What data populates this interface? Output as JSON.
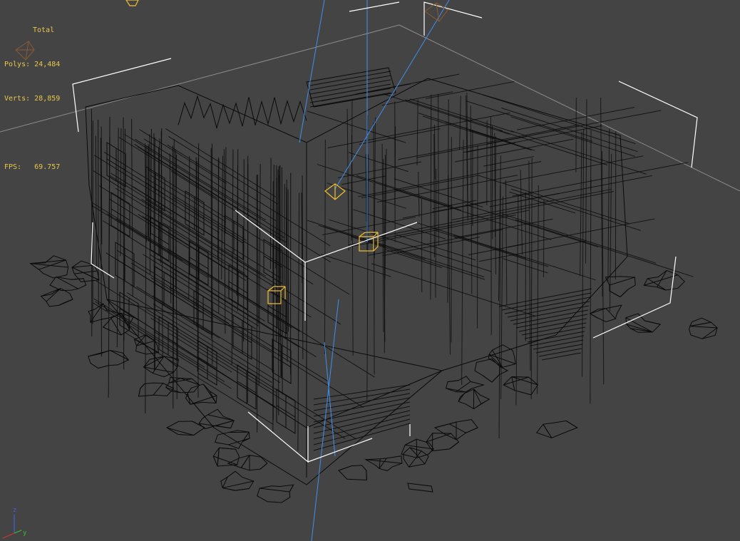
{
  "viewport": {
    "background": "#444444",
    "wire_color": "#0b0b0b",
    "selection_color": "#ffffff",
    "grid_color": "#9a9a9a",
    "camera_line_color": "#3f8ff0",
    "light_gizmo_color": "#f0c030"
  },
  "stats": {
    "title": "Total",
    "polys_label": "Polys:",
    "polys_value": "24,484",
    "verts_label": "Verts:",
    "verts_value": "28,859",
    "fps_label": "FPS:",
    "fps_value": "69.757"
  },
  "axis_tripod": {
    "z": "z",
    "y": "y",
    "x_color": "#d83030",
    "y_color": "#30c030",
    "z_color": "#4060e0"
  },
  "icons": {
    "light": "light-gizmo-icon",
    "camera": "camera-icon",
    "tripod": "axis-tripod-icon"
  }
}
